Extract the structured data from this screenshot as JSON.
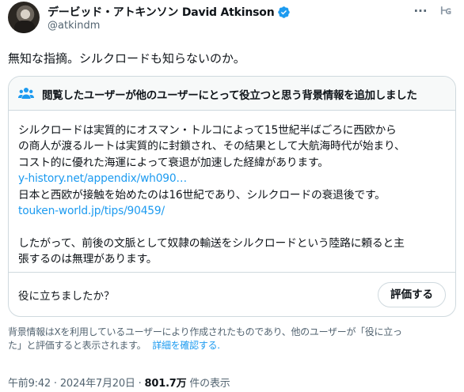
{
  "author": {
    "display_name": "デービッド・アトキンソン David Atkinson",
    "handle": "@atkindm",
    "verified_icon": "verified-badge-icon",
    "more_icon": "more-options-icon",
    "grok_icon": "grok-icon",
    "grok_label": "Ꮀɢ"
  },
  "tweet": {
    "text": "無知な指摘。シルクロードも知らないのか。"
  },
  "community_note": {
    "title": "閲覧したユーザーが他のユーザーにとって役立つと思う背景情報を追加しました",
    "body_lines": [
      "シルクロードは実質的にオスマン・トルコによって15世紀半ばごろに西欧から",
      "の商人が渡るルートは実質的に封鎖され、その結果として大航海時代が始まり、",
      "コスト的に優れた海運によって衰退が加速した経緯があります。",
      "y-history.net/appendix/wh090…",
      "日本と西欧が接触を始めたのは16世紀であり、シルクロードの衰退後です。",
      "touken-world.jp/tips/90459/",
      "",
      "したがって、前後の文脈として奴隷の輸送をシルクロードという陸路に頼ると主",
      "張するのは無理があります。"
    ],
    "rate_question": "役に立ちましたか？",
    "rate_button": "評価する"
  },
  "footnote": {
    "line1": "背景情報はXを利用しているユーザーにより作成されたものであり、他のユーザーが「役に立っ",
    "line2": "た」と評価すると表示されます。",
    "link": "詳細を確認する."
  },
  "meta": {
    "time": "午前9:42",
    "separator": " · ",
    "date": "2024年7月20日",
    "views": "801.7万",
    "views_label": " 件の表示"
  },
  "colors": {
    "link": "#1d9bf0",
    "verified": "#1d9bf0",
    "secondary_text": "#536471",
    "border": "#cfd9de"
  }
}
